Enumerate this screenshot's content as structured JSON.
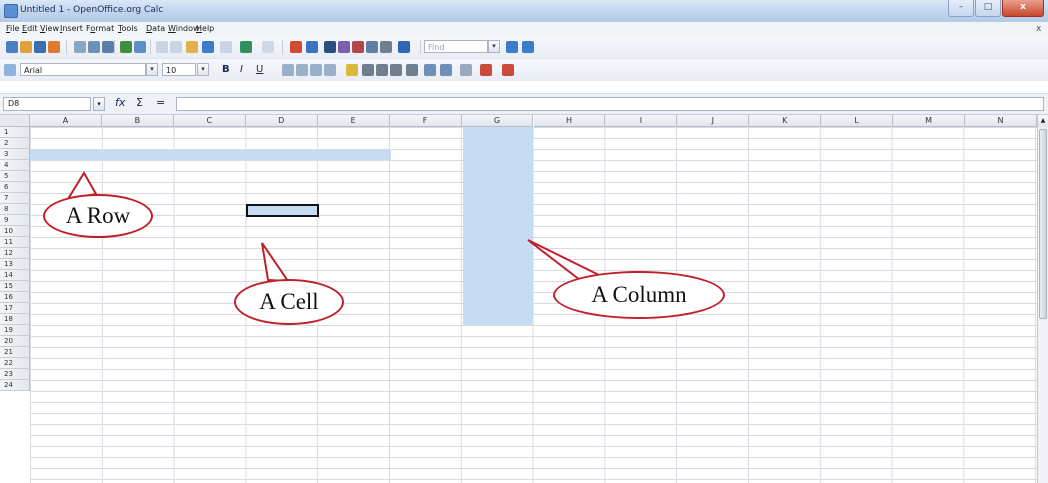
{
  "window": {
    "title": "Untitled 1 - OpenOffice.org Calc",
    "min": "–",
    "max": "□",
    "close": "x"
  },
  "menu": {
    "items": [
      {
        "label": "File",
        "u": "F"
      },
      {
        "label": "Edit",
        "u": "E"
      },
      {
        "label": "View",
        "u": "V"
      },
      {
        "label": "Insert",
        "u": "I"
      },
      {
        "label": "Format",
        "u": "o"
      },
      {
        "label": "Tools",
        "u": "T"
      },
      {
        "label": "Data",
        "u": "D"
      },
      {
        "label": "Window",
        "u": "W"
      },
      {
        "label": "Help",
        "u": "H"
      }
    ],
    "close_doc": "x"
  },
  "toolbar": {
    "find_placeholder": "Find"
  },
  "format_bar": {
    "font_name": "Arial",
    "font_size": "10",
    "bold": "B",
    "italic": "I",
    "underline": "U"
  },
  "formula_bar": {
    "name_box": "D8",
    "fx": "fx",
    "sum": "Σ",
    "equals": "=",
    "value": ""
  },
  "grid": {
    "columns": [
      "A",
      "B",
      "C",
      "D",
      "E",
      "F",
      "G",
      "H",
      "I",
      "J",
      "K",
      "L",
      "M",
      "N"
    ],
    "rows": [
      "1",
      "2",
      "3",
      "4",
      "5",
      "6",
      "7",
      "8",
      "9",
      "10",
      "11",
      "12",
      "13",
      "14",
      "15",
      "16",
      "17",
      "18",
      "19",
      "20",
      "21",
      "22",
      "23",
      "24"
    ],
    "selected_cell": "D8",
    "highlight_row": "3",
    "highlight_column": "G"
  },
  "annotations": {
    "row_label": "A Row",
    "cell_label": "A Cell",
    "column_label": "A Column",
    "outline_color": "#c0202a"
  }
}
